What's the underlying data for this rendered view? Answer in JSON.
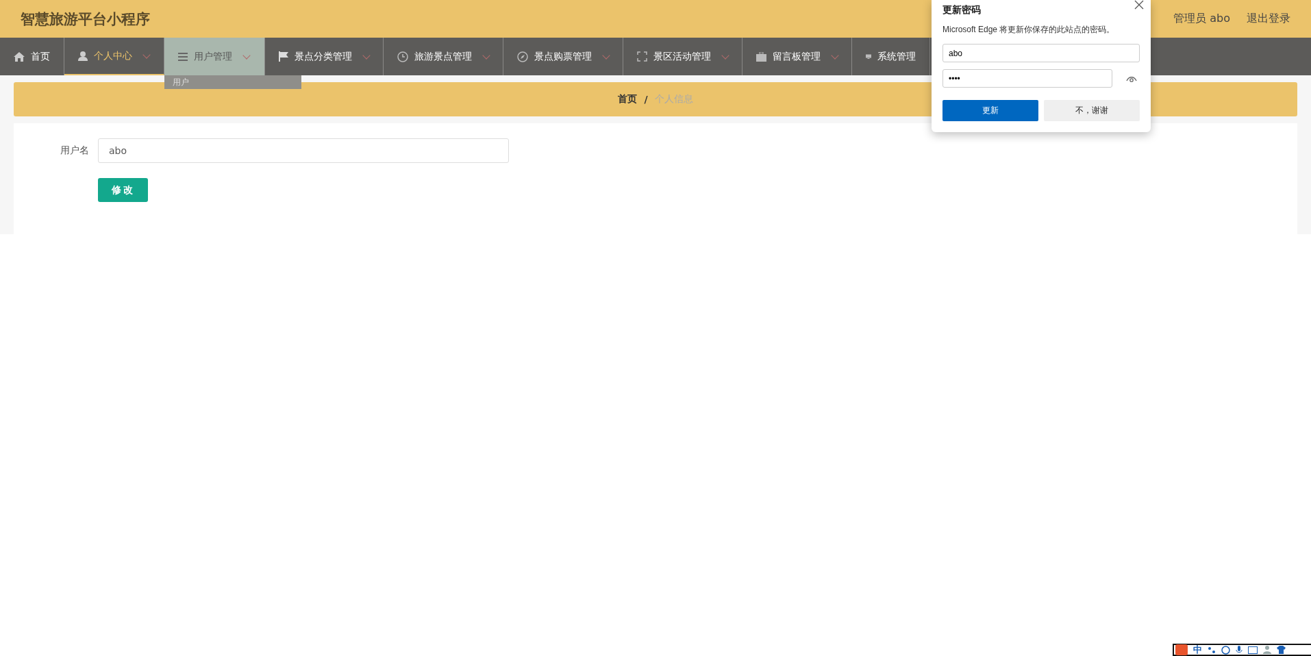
{
  "header": {
    "title": "智慧旅游平台小程序",
    "user": "管理员 abo",
    "logout": "退出登录"
  },
  "nav": [
    {
      "label": "首页",
      "selected": false,
      "hovered": false,
      "has_menu": false
    },
    {
      "label": "个人中心",
      "selected": true,
      "hovered": false,
      "has_menu": true
    },
    {
      "label": "用户管理",
      "selected": false,
      "hovered": true,
      "has_menu": true
    },
    {
      "label": "景点分类管理",
      "selected": false,
      "hovered": false,
      "has_menu": true
    },
    {
      "label": "旅游景点管理",
      "selected": false,
      "hovered": false,
      "has_menu": true
    },
    {
      "label": "景点购票管理",
      "selected": false,
      "hovered": false,
      "has_menu": true
    },
    {
      "label": "景区活动管理",
      "selected": false,
      "hovered": false,
      "has_menu": true
    },
    {
      "label": "留言板管理",
      "selected": false,
      "hovered": false,
      "has_menu": true
    },
    {
      "label": "系统管理",
      "selected": false,
      "hovered": false,
      "has_menu": false
    }
  ],
  "dropdown": {
    "items": [
      "用户"
    ]
  },
  "breadcrumb": [
    {
      "label": "首页",
      "current": false
    },
    {
      "label": "个人信息",
      "current": true
    }
  ],
  "breadcrumb_separator": "/",
  "form": {
    "fields": [
      {
        "label": "用户名",
        "value": "abo"
      }
    ],
    "button": "修改"
  },
  "dialog": {
    "title": "更新密码",
    "message": "Microsoft Edge 将更新你保存的此站点的密码。",
    "username": "abo",
    "password": "••••",
    "buttons": [
      {
        "label": "更新",
        "kind": "primary"
      },
      {
        "label": "不，谢谢",
        "kind": "secondary"
      }
    ]
  },
  "ime_toolbar": {
    "label": "中"
  }
}
